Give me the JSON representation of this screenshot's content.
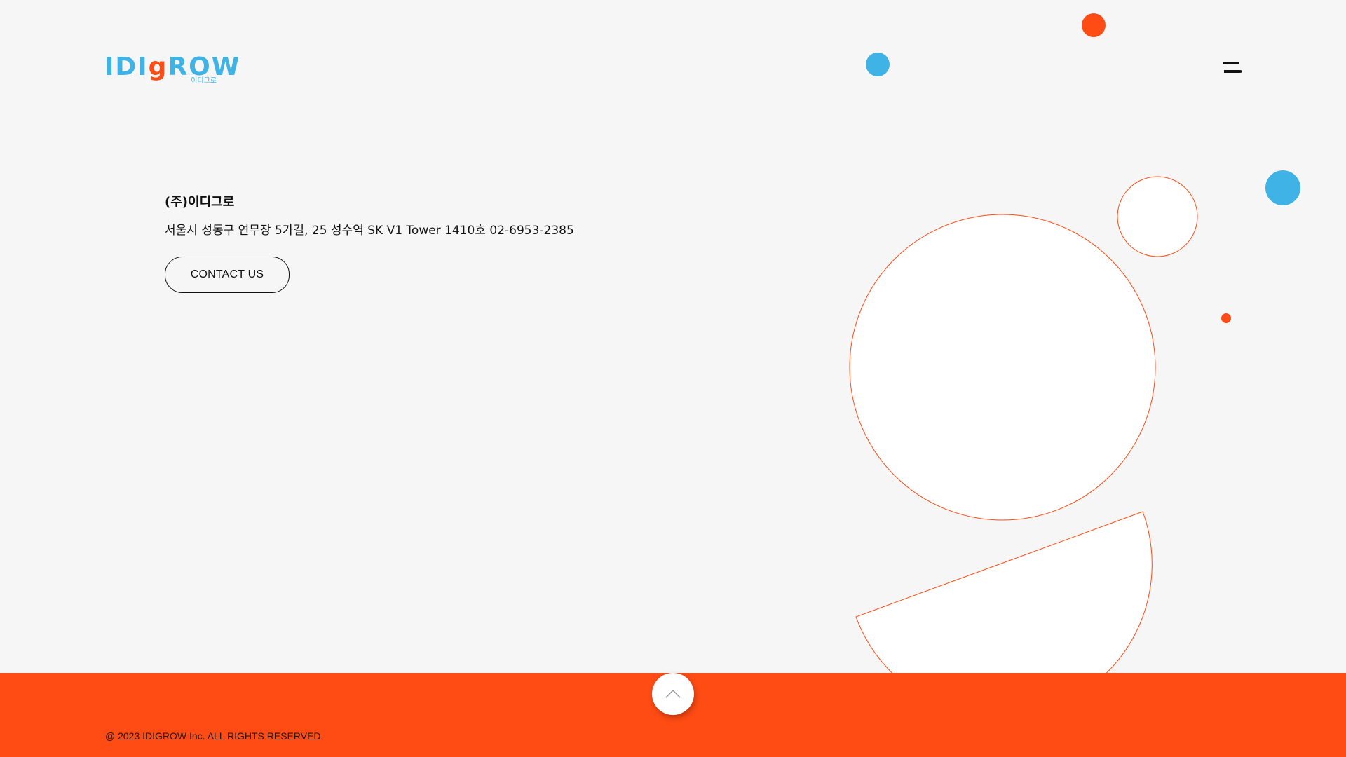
{
  "header": {
    "logo_text": "IDIGROW",
    "logo_sub": "이디그로"
  },
  "company": {
    "name": "(주)이디그로",
    "address": "서울시 성동구 연무장 5가길, 25 성수역 SK V1 Tower 1410호 02-6953-2385"
  },
  "contact": {
    "button_label": "CONTACT US"
  },
  "footer": {
    "copyright": "@ 2023 IDIGROW Inc. ALL RIGHTS RESERVED."
  },
  "colors": {
    "accent_orange": "#ff4b14",
    "accent_blue": "#3fb2e6",
    "background": "#f6f6f6",
    "text": "#111111"
  },
  "icons": {
    "menu": "hamburger-icon",
    "top": "chevron-up-icon"
  }
}
